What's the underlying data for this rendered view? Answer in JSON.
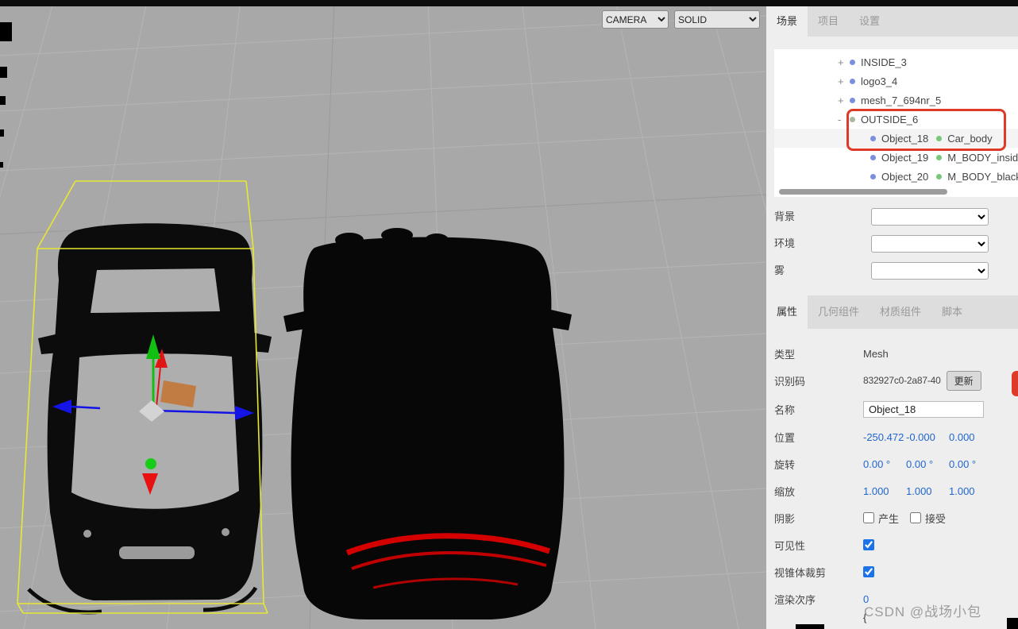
{
  "viewport": {
    "camera_select": "CAMERA",
    "shading_select": "SOLID"
  },
  "sidebar": {
    "tabs": {
      "scene": "场景",
      "project": "项目",
      "settings": "设置"
    },
    "outliner": {
      "rows": [
        {
          "expander": "+",
          "name": "INSIDE_3"
        },
        {
          "expander": "+",
          "name": "logo3_4"
        },
        {
          "expander": "+",
          "name": "mesh_7_694nr_5"
        },
        {
          "expander": "-",
          "name": "OUTSIDE_6"
        },
        {
          "name": "Object_18",
          "material": "Car_body"
        },
        {
          "name": "Object_19",
          "material": "M_BODY_inside"
        },
        {
          "name": "Object_20",
          "material": "M_BODY_black"
        }
      ]
    },
    "environment": {
      "background_label": "背景",
      "environment_label": "环境",
      "fog_label": "雾"
    },
    "property_tabs": {
      "object": "属性",
      "geometry": "几何组件",
      "material": "材质组件",
      "script": "脚本"
    },
    "object_panel": {
      "type_label": "类型",
      "type_value": "Mesh",
      "uuid_label": "识别码",
      "uuid_value": "832927c0-2a87-40",
      "uuid_new_button": "更新",
      "name_label": "名称",
      "name_value": "Object_18",
      "position_label": "位置",
      "position": [
        "-250.472",
        "-0.000",
        "0.000"
      ],
      "rotation_label": "旋转",
      "rotation": [
        "0.00 °",
        "0.00 °",
        "0.00 °"
      ],
      "scale_label": "缩放",
      "scale": [
        "1.000",
        "1.000",
        "1.000"
      ],
      "shadow_label": "阴影",
      "shadow_cast_label": "产生",
      "shadow_receive_label": "接受",
      "shadow_cast_checked": false,
      "shadow_receive_checked": false,
      "visible_label": "可见性",
      "visible_checked": true,
      "frustumcull_label": "视锥体裁剪",
      "frustumcull_checked": true,
      "renderorder_label": "渲染次序",
      "renderorder_value": "0",
      "userdata_preview": "{"
    }
  },
  "watermark": "CSDN @战场小包",
  "colors": {
    "viewport_background": "#a8a8a8",
    "number_text": "#2166cf",
    "annotation": "#dd3b28",
    "selection_box": "#e8e832",
    "axis_x": "#e01414",
    "axis_y": "#12c012",
    "axis_z": "#1414e6",
    "tail_light": "#d40000"
  }
}
